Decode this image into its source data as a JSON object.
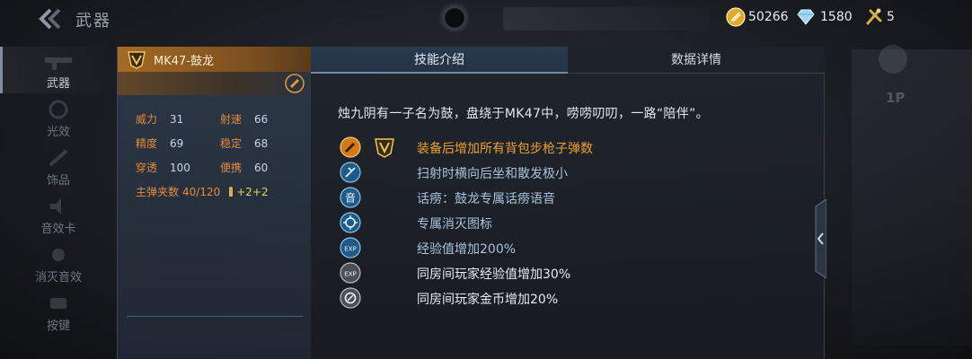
{
  "header": {
    "title": "武器",
    "currencies": [
      {
        "name": "gold",
        "value": "50266",
        "icon": "gold-coin-icon"
      },
      {
        "name": "diamond",
        "value": "1580",
        "icon": "diamond-icon"
      },
      {
        "name": "ticket",
        "value": "5",
        "icon": "ticket-icon"
      }
    ]
  },
  "nav": {
    "items": [
      {
        "label": "武器",
        "active": true
      },
      {
        "label": "光效",
        "active": false
      },
      {
        "label": "饰品",
        "active": false
      },
      {
        "label": "音效卡",
        "active": false
      },
      {
        "label": "消灭音效",
        "active": false
      },
      {
        "label": "按键",
        "active": false
      }
    ]
  },
  "weapon": {
    "name": "MK47-鼓龙",
    "rank_icon": "v-rank-icon",
    "stats": [
      {
        "label": "威力",
        "value": "31"
      },
      {
        "label": "射速",
        "value": "66"
      },
      {
        "label": "精度",
        "value": "69"
      },
      {
        "label": "稳定",
        "value": "68"
      },
      {
        "label": "穿透",
        "value": "100"
      },
      {
        "label": "便携",
        "value": "60"
      }
    ],
    "ammo_label": "主弹夹数",
    "ammo_value": "40/120",
    "ammo_bonus": "+2+2"
  },
  "tabs": {
    "skill": "技能介绍",
    "data": "数据详情"
  },
  "skills": {
    "intro": "烛九阴有一子名为鼓，盘绕于MK47中，唠唠叨叨，一路“陪伴”。",
    "items": [
      {
        "text": "装备后增加所有背包步枪子弹数",
        "color": "orange",
        "icon": "bullet-icon",
        "rank": true
      },
      {
        "text": "扫射时横向后坐和散发极小",
        "color": "blue",
        "icon": "spray-icon"
      },
      {
        "text": "话痨：鼓龙专属话痨语音",
        "color": "blue",
        "icon": "voice-icon",
        "icon_char": "音"
      },
      {
        "text": "专属消灭图标",
        "color": "blue",
        "icon": "kill-mark-icon"
      },
      {
        "text": "经验值增加200%",
        "color": "blue",
        "icon": "exp-icon",
        "icon_char": "EXP"
      },
      {
        "text": "同房间玩家经验值增加30%",
        "color": "white",
        "icon": "room-exp-icon",
        "icon_char": "EXP"
      },
      {
        "text": "同房间玩家金币增加20%",
        "color": "white",
        "icon": "room-gold-icon"
      }
    ]
  },
  "right_side": {
    "label": "1P"
  },
  "colors": {
    "accent_orange": "#f0a030",
    "skill_blue": "#a9c3de",
    "header_gold": "#a56a24"
  }
}
